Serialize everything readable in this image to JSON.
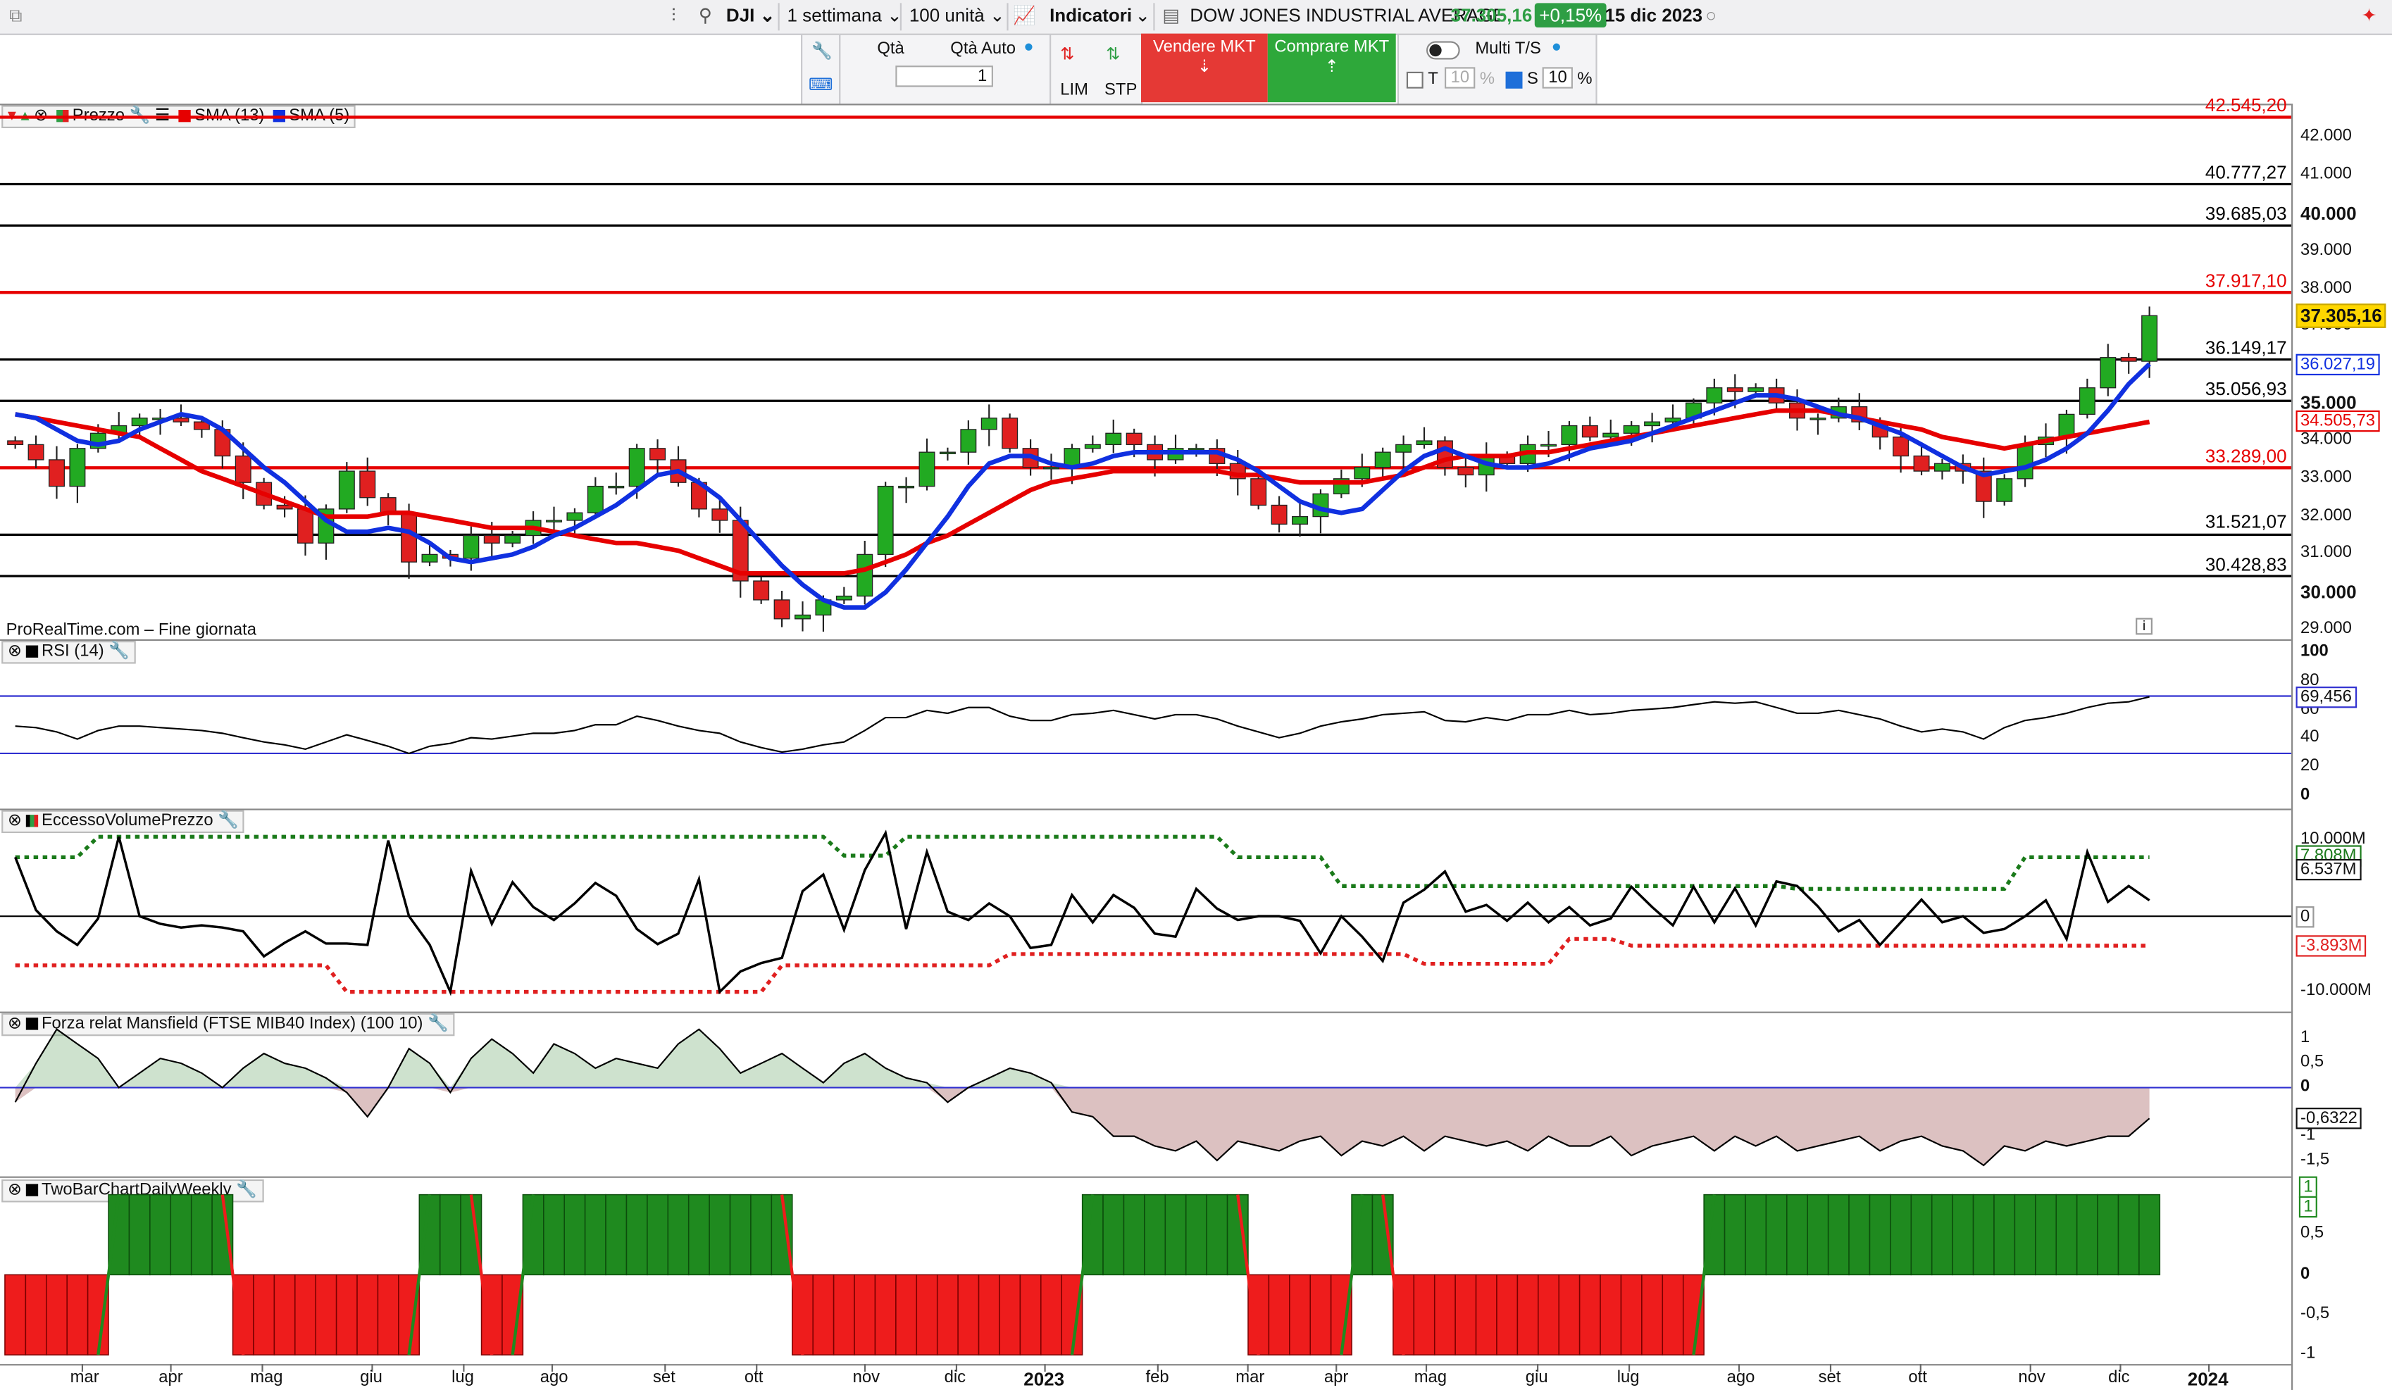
{
  "toolbar": {
    "symbol": "DJI",
    "timeframe": "1 settimana",
    "units": "100 unità",
    "indicators_label": "Indicatori",
    "instrument_name": "DOW JONES INDUSTRIAL AVERAGE",
    "last_price": "37.305,16",
    "change_pct": "+0,15%",
    "date": "15 dic 2023"
  },
  "order_bar": {
    "qty_label": "Qtà",
    "qty_auto_label": "Qtà Auto",
    "qty_value": "1",
    "lim_label": "LIM",
    "stp_label": "STP",
    "sell_label": "Vendere MKT",
    "buy_label": "Comprare MKT",
    "multi_label": "Multi T/S",
    "t_label": "T",
    "t_value": "10",
    "t_unit": "%",
    "s_label": "S",
    "s_value": "10",
    "s_unit": "%"
  },
  "price_panel": {
    "legend_price": "Prezzo",
    "legend_sma13": "SMA (13)",
    "legend_sma5": "SMA (5)",
    "watermark": "ProRealTime.com – Fine giornata",
    "info_icon": "i",
    "axis_ticks": [
      "42.000",
      "41.000",
      "40.000",
      "39.000",
      "38.000",
      "37.000",
      "35.000",
      "34.000",
      "33.000",
      "32.000",
      "31.000",
      "30.000",
      "29.000"
    ],
    "level_labels": [
      "42.545,20",
      "40.777,27",
      "39.685,03",
      "37.917,10",
      "36.149,17",
      "35.056,93",
      "33.289,00",
      "31.521,07",
      "30.428,83"
    ],
    "price_tag": "37.305,16",
    "sma5_tag": "36.027,19",
    "sma13_tag": "34.505,73",
    "colors": {
      "up": "#22aa22",
      "down": "#e02020",
      "sma13": "#e60000",
      "sma5": "#1030e0"
    }
  },
  "rsi_panel": {
    "legend": "RSI (14)",
    "axis_ticks": [
      "100",
      "80",
      "60",
      "40",
      "20",
      "0"
    ],
    "tag": "69,456"
  },
  "evp_panel": {
    "legend": "EccessoVolumePrezzo",
    "axis_ticks": [
      "10.000M",
      "0",
      "-10.000M"
    ],
    "tag_upper": "7.808M",
    "tag_value": "6.537M",
    "tag_zero": "0",
    "tag_lower": "-3.893M"
  },
  "mansfield_panel": {
    "legend": "Forza relat Mansfield (FTSE MIB40 Index) (100 10)",
    "axis_ticks": [
      "1",
      "0,5",
      "0",
      "-1",
      "-1,5"
    ],
    "tag": "-0,6322"
  },
  "twobar_panel": {
    "legend": "TwoBarChartDailyWeekly",
    "axis_ticks": [
      "1",
      "0,5",
      "0",
      "-0,5",
      "-1"
    ],
    "tag_a": "1",
    "tag_b": "1"
  },
  "time_axis": {
    "months": [
      "mar",
      "apr",
      "mag",
      "giu",
      "lug",
      "ago",
      "set",
      "ott",
      "nov",
      "dic",
      "2023",
      "feb",
      "mar",
      "apr",
      "mag",
      "giu",
      "lug",
      "ago",
      "set",
      "ott",
      "nov",
      "dic",
      "2024"
    ]
  },
  "chart_data": {
    "type": "candlestick",
    "title": "DOW JONES INDUSTRIAL AVERAGE",
    "timeframe": "weekly",
    "ylim": [
      28800,
      42900
    ],
    "horizontal_levels": [
      {
        "value": 42545.2,
        "color": "red"
      },
      {
        "value": 40777.27,
        "color": "black"
      },
      {
        "value": 39685.03,
        "color": "black"
      },
      {
        "value": 37917.1,
        "color": "red"
      },
      {
        "value": 36149.17,
        "color": "black"
      },
      {
        "value": 35056.93,
        "color": "black"
      },
      {
        "value": 33289.0,
        "color": "red"
      },
      {
        "value": 31521.07,
        "color": "black"
      },
      {
        "value": 30428.83,
        "color": "black"
      }
    ],
    "candles_open": [
      34000,
      33900,
      33500,
      32800,
      33800,
      34200,
      34400,
      34600,
      34600,
      34500,
      34300,
      33600,
      32900,
      32300,
      32200,
      31300,
      32200,
      33200,
      32500,
      32100,
      30800,
      31000,
      30900,
      31500,
      31300,
      31500,
      31900,
      31900,
      32100,
      32800,
      32800,
      33800,
      33500,
      32900,
      32200,
      31900,
      30300,
      29800,
      29300,
      29400,
      29800,
      29900,
      31000,
      32800,
      32800,
      33700,
      33700,
      34300,
      34600,
      33800,
      33300,
      33300,
      33800,
      33900,
      34200,
      33900,
      33500,
      33800,
      33800,
      33400,
      33000,
      32300,
      31800,
      32000,
      32600,
      33000,
      33300,
      33700,
      33900,
      34000,
      33300,
      33100,
      33600,
      33400,
      33900,
      33900,
      34400,
      34100,
      34200,
      34400,
      34500,
      34600,
      35000,
      35400,
      35300,
      35400,
      35000,
      34600,
      34600,
      34900,
      34500,
      34100,
      33600,
      33200,
      33400,
      33200,
      32400,
      33000,
      33900,
      34100,
      34700,
      35400,
      36200,
      36100
    ],
    "candles_close": [
      33900,
      33500,
      32800,
      33800,
      34200,
      34400,
      34600,
      34600,
      34500,
      34300,
      33600,
      32900,
      32300,
      32200,
      31300,
      32200,
      33200,
      32500,
      32100,
      30800,
      31000,
      30900,
      31500,
      31300,
      31500,
      31900,
      31900,
      32100,
      32800,
      32800,
      33800,
      33500,
      32900,
      32200,
      31900,
      30300,
      29800,
      29300,
      29400,
      29800,
      29900,
      31000,
      32800,
      32800,
      33700,
      33700,
      34300,
      34600,
      33800,
      33300,
      33300,
      33800,
      33900,
      34200,
      33900,
      33500,
      33800,
      33800,
      33400,
      33000,
      32300,
      31800,
      32000,
      32600,
      33000,
      33300,
      33700,
      33900,
      34000,
      33300,
      33100,
      33600,
      33400,
      33900,
      33900,
      34400,
      34100,
      34200,
      34400,
      34500,
      34600,
      35000,
      35400,
      35300,
      35400,
      35000,
      34600,
      34600,
      34900,
      34500,
      34100,
      33600,
      33200,
      33400,
      33200,
      32400,
      33000,
      33900,
      34100,
      34700,
      35400,
      36200,
      36100,
      37305
    ],
    "sma13": [
      34700,
      34600,
      34500,
      34400,
      34300,
      34200,
      34100,
      33800,
      33500,
      33200,
      33000,
      32800,
      32600,
      32400,
      32200,
      32000,
      32000,
      32000,
      32100,
      32100,
      32000,
      31900,
      31800,
      31700,
      31700,
      31700,
      31600,
      31500,
      31400,
      31300,
      31300,
      31200,
      31100,
      30900,
      30700,
      30500,
      30500,
      30500,
      30500,
      30500,
      30500,
      30600,
      30800,
      31000,
      31300,
      31500,
      31800,
      32100,
      32400,
      32700,
      32900,
      33000,
      33100,
      33200,
      33200,
      33200,
      33200,
      33200,
      33200,
      33100,
      33100,
      33000,
      32900,
      32900,
      32900,
      32900,
      33000,
      33100,
      33300,
      33500,
      33600,
      33600,
      33600,
      33700,
      33700,
      33800,
      33900,
      34000,
      34100,
      34200,
      34300,
      34400,
      34500,
      34600,
      34700,
      34800,
      34800,
      34800,
      34700,
      34600,
      34500,
      34400,
      34300,
      34100,
      34000,
      33900,
      33800,
      33900,
      34000,
      34100,
      34200,
      34300,
      34400,
      34500
    ],
    "sma5": [
      34700,
      34600,
      34300,
      34000,
      33900,
      34000,
      34300,
      34500,
      34700,
      34600,
      34300,
      33800,
      33300,
      32900,
      32400,
      31900,
      31600,
      31600,
      31700,
      31600,
      31300,
      30900,
      30800,
      30900,
      31000,
      31200,
      31500,
      31700,
      32000,
      32300,
      32700,
      33100,
      33200,
      32900,
      32500,
      31900,
      31300,
      30700,
      30200,
      29800,
      29600,
      29600,
      30000,
      30600,
      31300,
      32000,
      32800,
      33400,
      33600,
      33600,
      33400,
      33300,
      33400,
      33600,
      33700,
      33700,
      33700,
      33700,
      33700,
      33500,
      33200,
      32800,
      32400,
      32200,
      32100,
      32200,
      32700,
      33200,
      33600,
      33800,
      33600,
      33400,
      33300,
      33300,
      33400,
      33600,
      33800,
      33900,
      34000,
      34200,
      34400,
      34600,
      34800,
      35000,
      35200,
      35200,
      35100,
      34900,
      34700,
      34600,
      34400,
      34200,
      33900,
      33600,
      33300,
      33100,
      33200,
      33300,
      33500,
      33800,
      34200,
      34800,
      35500,
      36027
    ],
    "rsi": [
      49,
      48,
      45,
      40,
      46,
      49,
      49,
      48,
      47,
      46,
      44,
      41,
      38,
      36,
      33,
      38,
      43,
      39,
      35,
      30,
      35,
      37,
      41,
      40,
      42,
      44,
      44,
      46,
      50,
      50,
      56,
      53,
      49,
      46,
      44,
      38,
      34,
      31,
      33,
      36,
      38,
      46,
      55,
      55,
      60,
      58,
      62,
      62,
      56,
      53,
      53,
      57,
      58,
      60,
      57,
      54,
      57,
      57,
      54,
      49,
      45,
      41,
      44,
      49,
      52,
      54,
      57,
      58,
      59,
      53,
      52,
      55,
      53,
      57,
      57,
      60,
      57,
      58,
      60,
      61,
      62,
      64,
      66,
      65,
      66,
      62,
      58,
      58,
      60,
      57,
      54,
      49,
      45,
      47,
      45,
      40,
      48,
      53,
      55,
      58,
      62,
      65,
      66,
      69.456
    ],
    "evp": [
      7800000,
      800000,
      -2000000,
      -3800000,
      -300000,
      10500000,
      0,
      -1000000,
      -1500000,
      -1200000,
      -1500000,
      -2000000,
      -5300000,
      -3500000,
      -2000000,
      -3600000,
      -3600000,
      -3800000,
      10000000,
      0,
      -3800000,
      -10000000,
      6000000,
      -1000000,
      4500000,
      1200000,
      -500000,
      1700000,
      4400000,
      2700000,
      -1700000,
      -3700000,
      -2300000,
      4900000,
      -10000000,
      -7300000,
      -6200000,
      -5500000,
      3300000,
      5500000,
      -1800000,
      6100000,
      11000000,
      -1700000,
      8500000,
      600000,
      -500000,
      1700000,
      0,
      -4200000,
      -3800000,
      2800000,
      -800000,
      2800000,
      1100000,
      -2300000,
      -2700000,
      3600000,
      1000000,
      -500000,
      0,
      0,
      -600000,
      -4900000,
      0,
      -2700000,
      -5900000,
      1800000,
      3500000,
      5900000,
      600000,
      1500000,
      -600000,
      1800000,
      -800000,
      1200000,
      -1200000,
      -300000,
      3900000,
      1200000,
      -1200000,
      3900000,
      -800000,
      3700000,
      -1200000,
      4600000,
      4000000,
      1300000,
      -2000000,
      -500000,
      -3800000,
      -800000,
      2200000,
      -800000,
      0,
      -2200000,
      -1700000,
      0,
      2100000,
      -3000000,
      8500000,
      1900000,
      4000000,
      2100000,
      4000000,
      0,
      6537000
    ],
    "evp_upper": [
      8500000,
      8500000,
      8500000,
      11000000,
      11000000,
      11000000,
      11000000,
      11000000,
      11000000,
      11000000,
      11000000,
      11000000,
      11000000,
      11000000,
      11000000,
      11000000,
      11000000,
      11000000,
      11000000,
      11000000,
      11000000,
      11000000,
      11000000,
      11000000,
      11000000,
      11000000,
      11000000,
      11000000,
      11000000,
      11000000,
      11000000,
      11000000,
      11000000,
      11000000,
      10500000,
      10500000,
      10500000,
      10500000,
      10500000,
      10500000,
      10500000,
      10500000,
      10500000,
      10500000,
      10500000,
      10500000,
      10500000,
      10500000,
      10500000,
      10500000,
      10500000,
      8800000,
      8500000,
      10500000,
      10500000,
      10500000,
      10500000,
      10500000,
      10500000,
      10500000,
      10500000,
      10500000,
      10500000,
      10500000,
      10500000,
      10500000,
      10500000,
      10500000,
      10500000,
      10500000,
      10500000,
      10500000,
      10500000,
      10500000,
      10500000,
      10500000,
      10500000,
      10500000,
      10500000,
      10500000,
      10500000,
      10500000,
      10500000,
      10500000,
      10500000,
      10500000,
      10500000,
      10500000,
      10500000,
      10500000,
      10500000,
      10500000,
      10500000,
      10500000,
      10500000,
      10500000,
      10500000,
      10500000,
      10500000,
      10500000,
      10500000,
      8800000,
      8800000,
      6000000,
      6000000,
      6000000,
      6000000,
      6000000,
      6000000,
      6000000,
      6000000,
      6000000,
      6000000,
      6000000,
      6000000,
      6000000,
      6000000,
      6000000,
      6000000,
      6000000,
      6000000,
      6000000,
      6000000,
      6000000,
      6000000,
      6000000,
      6000000,
      6000000,
      6000000,
      6000000,
      6000000,
      6000000,
      6000000,
      5000000,
      5000000,
      5000000,
      5000000,
      5000000,
      5000000,
      5000000,
      5000000,
      5000000,
      5000000,
      5000000,
      5000000,
      5000000,
      5000000,
      5000000,
      5000000,
      7808000,
      7808000,
      7808000,
      7808000,
      7808000,
      7808000,
      7808000
    ],
    "evp_lower": [
      -10000000
    ],
    "mansfield": [
      -0.3,
      0.5,
      1.2,
      0.9,
      0.6,
      0.0,
      0.3,
      0.6,
      0.5,
      0.3,
      0.0,
      0.4,
      0.7,
      0.5,
      0.4,
      0.2,
      -0.1,
      -0.6,
      0.0,
      0.8,
      0.5,
      -0.1,
      0.6,
      1.0,
      0.7,
      0.3,
      0.9,
      0.7,
      0.4,
      0.6,
      0.5,
      0.4,
      0.9,
      1.2,
      0.8,
      0.3,
      0.5,
      0.7,
      0.4,
      0.1,
      0.5,
      0.7,
      0.4,
      0.2,
      0.1,
      -0.3,
      0.0,
      0.2,
      0.4,
      0.3,
      0.1,
      -0.5,
      -0.6,
      -1.0,
      -1.0,
      -1.2,
      -1.3,
      -1.1,
      -1.5,
      -1.1,
      -1.2,
      -1.3,
      -1.1,
      -1.0,
      -1.4,
      -1.1,
      -1.2,
      -1.0,
      -1.3,
      -1.0,
      -1.1,
      -1.2,
      -1.1,
      -1.3,
      -1.0,
      -1.2,
      -1.2,
      -1.0,
      -1.4,
      -1.2,
      -1.1,
      -1.0,
      -1.3,
      -1.0,
      -1.2,
      -1.0,
      -1.3,
      -1.2,
      -1.1,
      -1.0,
      -1.3,
      -1.1,
      -1.0,
      -1.2,
      -1.3,
      -1.6,
      -1.2,
      -1.3,
      -1.1,
      -1.2,
      -1.1,
      -1.0,
      -1.0,
      -0.6322
    ],
    "twobar": [
      -1,
      -1,
      -1,
      -1,
      -1,
      1,
      1,
      1,
      1,
      1,
      1,
      -1,
      -1,
      -1,
      -1,
      -1,
      -1,
      -1,
      -1,
      -1,
      1,
      1,
      1,
      -1,
      -1,
      1,
      1,
      1,
      1,
      1,
      1,
      1,
      1,
      1,
      1,
      1,
      1,
      1,
      -1,
      -1,
      -1,
      -1,
      -1,
      -1,
      -1,
      -1,
      -1,
      -1,
      -1,
      -1,
      -1,
      -1,
      1,
      1,
      1,
      1,
      1,
      1,
      1,
      1,
      -1,
      -1,
      -1,
      -1,
      -1,
      1,
      1,
      -1,
      -1,
      -1,
      -1,
      -1,
      -1,
      -1,
      -1,
      -1,
      -1,
      -1,
      -1,
      -1,
      -1,
      -1,
      1,
      1,
      1,
      1,
      1,
      1,
      1,
      1,
      1,
      1,
      1,
      1,
      1,
      1,
      1,
      1,
      1,
      1,
      1,
      1,
      1,
      1,
      1,
      1,
      1,
      1,
      1,
      1
    ]
  }
}
